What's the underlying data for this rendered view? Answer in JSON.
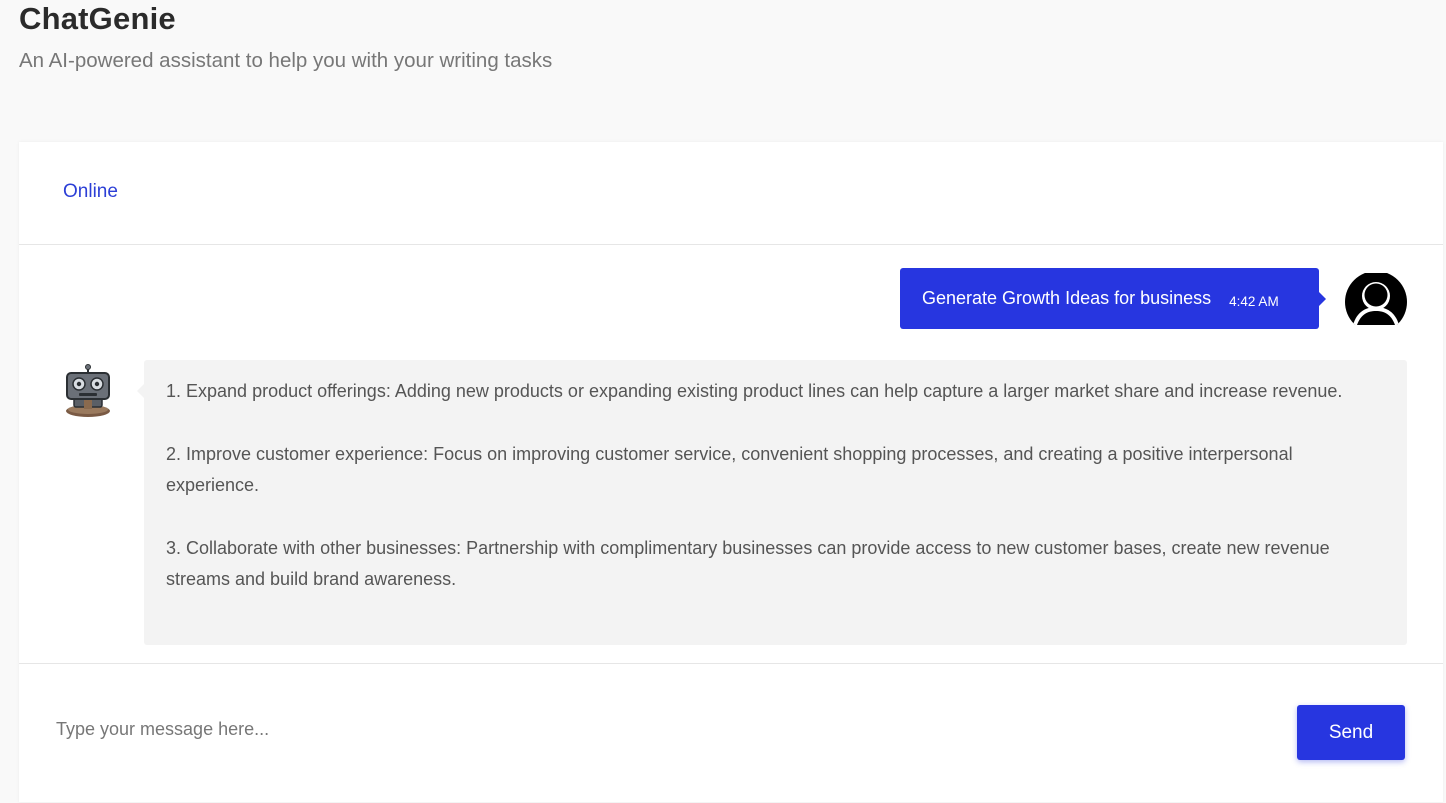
{
  "app": {
    "title": "ChatGenie",
    "subtitle": "An AI-powered assistant to help you with your writing tasks"
  },
  "chat": {
    "status": "Online",
    "messages": [
      {
        "sender": "user",
        "text": "Generate Growth Ideas for business",
        "time": "4:42 AM",
        "avatar_icon": "user-avatar-icon"
      },
      {
        "sender": "bot",
        "avatar_icon": "robot-icon",
        "paragraphs": [
          "1. Expand product offerings: Adding new products or expanding existing product lines can help capture a larger market share and increase revenue.",
          "2. Improve customer experience: Focus on improving customer service, convenient shopping processes, and creating a positive interpersonal experience.",
          "3. Collaborate with other businesses: Partnership with complimentary businesses can provide access to new customer bases, create new revenue streams and build brand awareness."
        ]
      }
    ]
  },
  "composer": {
    "placeholder": "Type your message here...",
    "value": "",
    "send_label": "Send"
  },
  "colors": {
    "accent": "#2736e0",
    "status_text": "#2c3fd6",
    "page_background": "#f9f9f9",
    "bot_bubble": "#f3f3f3"
  }
}
